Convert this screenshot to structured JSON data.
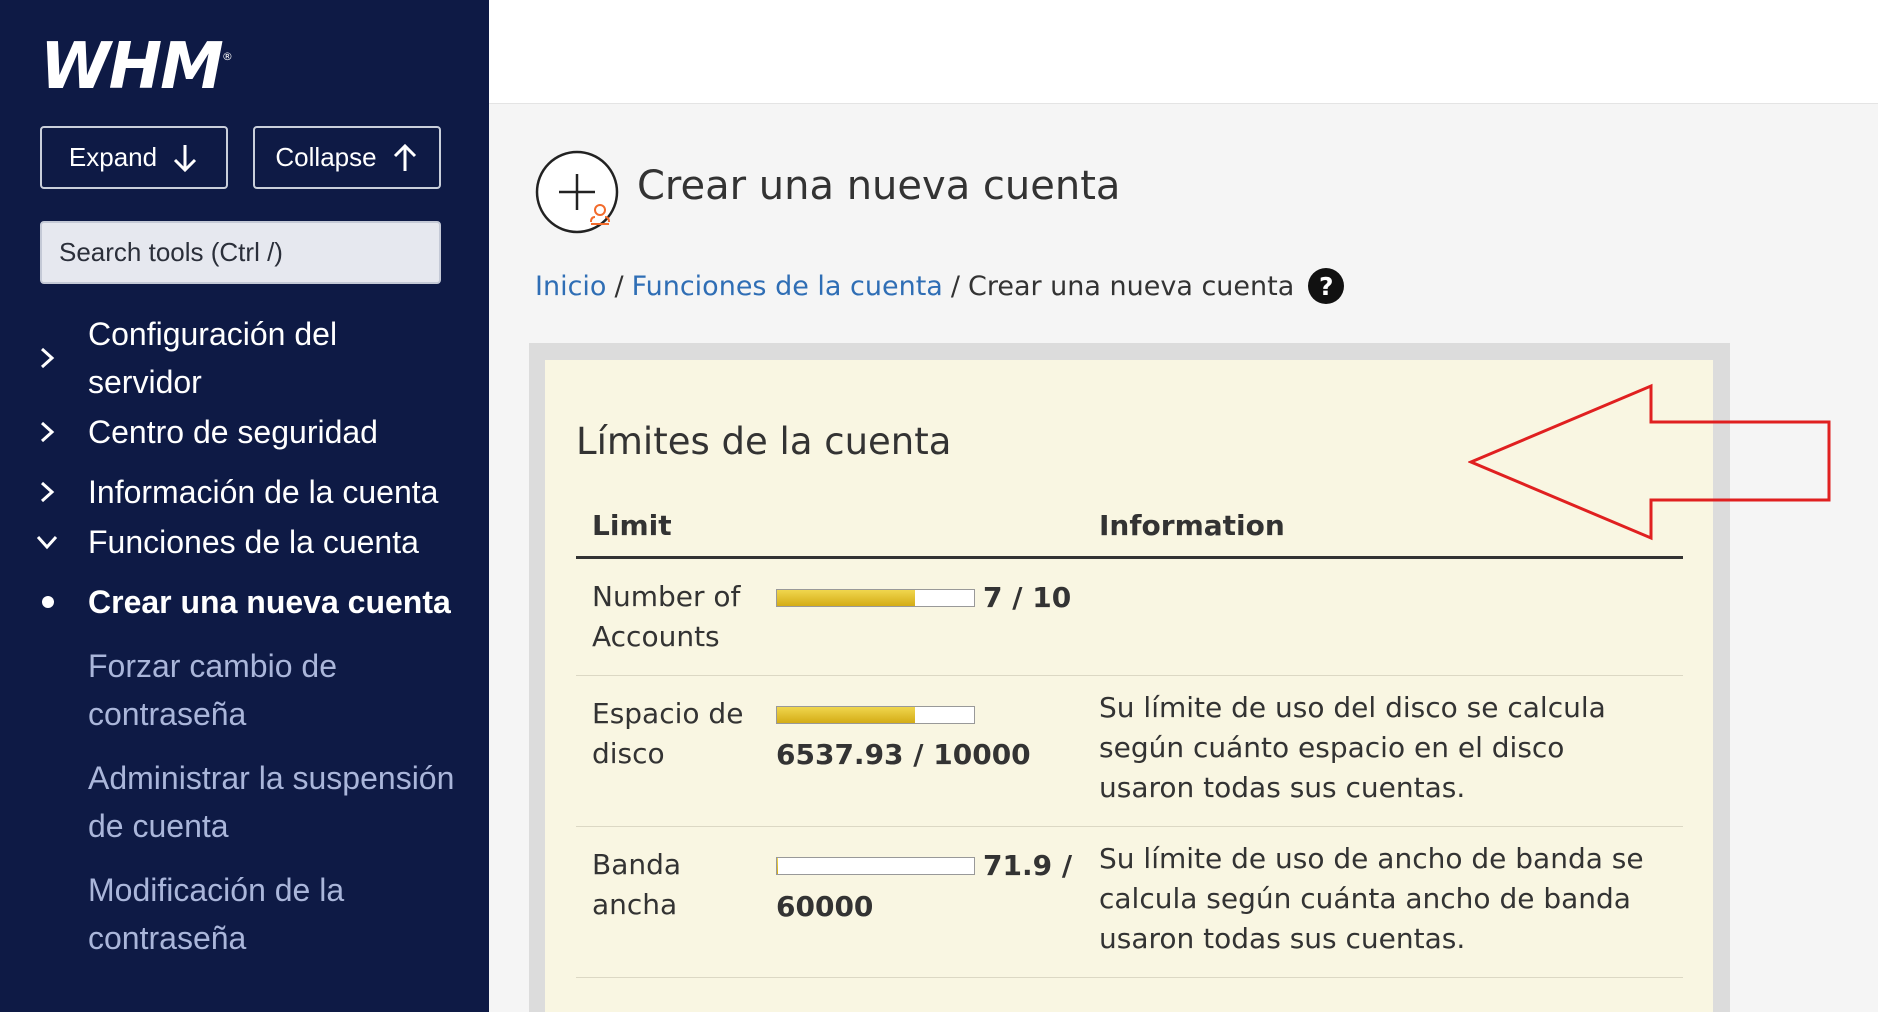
{
  "sidebar": {
    "logo": "WHM",
    "logo_mark": "®",
    "expand_label": "Expand",
    "collapse_label": "Collapse",
    "search_placeholder": "Search tools (Ctrl /)",
    "items": [
      {
        "label": "Configuración del servidor",
        "state": "collapsed"
      },
      {
        "label": "Centro de seguridad",
        "state": "collapsed"
      },
      {
        "label": "Información de la cuenta",
        "state": "collapsed"
      },
      {
        "label": "Funciones de la cuenta",
        "state": "expanded"
      }
    ],
    "subitems": [
      {
        "label": "Crear una nueva cuenta",
        "current": true
      },
      {
        "label": "Forzar cambio de contraseña"
      },
      {
        "label": "Administrar la suspensión de cuenta"
      },
      {
        "label": "Modificación de la contraseña"
      }
    ]
  },
  "page": {
    "title": "Crear una nueva cuenta",
    "breadcrumb": {
      "home": "Inicio",
      "sep1": "/",
      "section": "Funciones de la cuenta",
      "sep2": "/",
      "current": "Crear una nueva cuenta",
      "help": "?"
    }
  },
  "limits": {
    "title": "Límites de la cuenta",
    "col_limit": "Limit",
    "col_info": "Information",
    "rows": [
      {
        "name": "Number of Accounts",
        "usage": "7 / 10",
        "fill": 0.7,
        "info": ""
      },
      {
        "name": "Espacio de disco",
        "usage": "6537.93 / 10000",
        "fill": 0.7,
        "info": "Su límite de uso del disco se calcula según cuánto espacio en el disco usaron todas sus cuentas."
      },
      {
        "name": "Banda ancha",
        "usage": "71.9 / 60000",
        "fill": 0.0012,
        "info": "Su límite de uso de ancho de banda se calcula según cuánta ancho de banda usaron todas sus cuentas."
      }
    ]
  },
  "colors": {
    "sidebar_bg": "#0e1a45",
    "link": "#2f6eb5",
    "panel_bg": "#f9f6e2",
    "bar_fill": "#e0bd2c",
    "annotation_arrow": "#e02020"
  },
  "icons": {
    "expand": "arrow-down-icon",
    "collapse": "arrow-up-icon",
    "nav_collapsed": "chevron-right-icon",
    "nav_expanded": "chevron-down-icon",
    "page": "add-account-icon",
    "help": "help-icon"
  }
}
